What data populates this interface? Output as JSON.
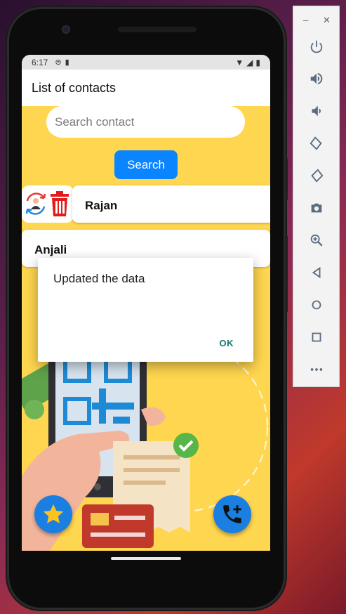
{
  "status_bar": {
    "time": "6:17"
  },
  "app_bar": {
    "title": "List of contacts"
  },
  "search": {
    "placeholder": "Search contact",
    "button_label": "Search"
  },
  "contacts": [
    {
      "name": "Rajan"
    },
    {
      "name": "Anjali"
    }
  ],
  "dialog": {
    "message": "Updated the data",
    "ok_label": "OK"
  },
  "fabs": {
    "left_icon": "star-icon",
    "right_icon": "add-call-icon"
  },
  "colors": {
    "background": "#ffd64f",
    "accent_blue": "#0a84ff",
    "delete_red": "#e21b1b",
    "dialog_button": "#0c7a6e"
  }
}
